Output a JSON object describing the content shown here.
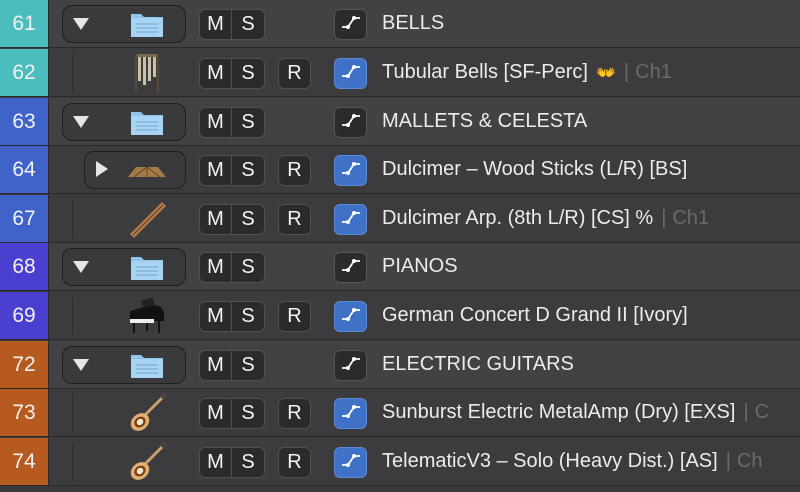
{
  "tracks": [
    {
      "number": "61",
      "type": "folder",
      "color": "#4bbdbd",
      "name": "BELLS",
      "icon": "folder-icon"
    },
    {
      "number": "62",
      "type": "track",
      "color": "#4bbdbd",
      "name": "Tubular Bells [SF-Perc]",
      "extra": "👐",
      "channel": "Ch1",
      "icon": "tubular-bells-icon"
    },
    {
      "number": "63",
      "type": "folder",
      "color": "#3f63c9",
      "name": "MALLETS & CELESTA",
      "icon": "folder-icon"
    },
    {
      "number": "64",
      "type": "track-sub",
      "color": "#3f63c9",
      "name": "Dulcimer – Wood Sticks (L/R) [BS]",
      "icon": "dulcimer-icon"
    },
    {
      "number": "67",
      "type": "track",
      "color": "#3f63c9",
      "name": "Dulcimer Arp. (8th L/R) [CS] %",
      "channel": "Ch1",
      "icon": "dulcimer-stick-icon"
    },
    {
      "number": "68",
      "type": "folder",
      "color": "#4a3fcf",
      "name": "PIANOS",
      "icon": "folder-icon"
    },
    {
      "number": "69",
      "type": "track",
      "color": "#4a3fcf",
      "name": "German Concert D Grand II [Ivory]",
      "icon": "grand-piano-icon"
    },
    {
      "number": "72",
      "type": "folder",
      "color": "#b65a1f",
      "name": "ELECTRIC GUITARS",
      "icon": "folder-icon"
    },
    {
      "number": "73",
      "type": "track",
      "color": "#b65a1f",
      "name": "Sunburst Electric MetalAmp (Dry) [EXS]",
      "channel": "C",
      "icon": "electric-guitar-icon"
    },
    {
      "number": "74",
      "type": "track",
      "color": "#b65a1f",
      "name": "TelematicV3 – Solo (Heavy Dist.) [AS]",
      "channel": "Ch",
      "icon": "electric-guitar-icon"
    }
  ],
  "labels": {
    "mute": "M",
    "solo": "S",
    "record": "R",
    "separator": "|"
  }
}
